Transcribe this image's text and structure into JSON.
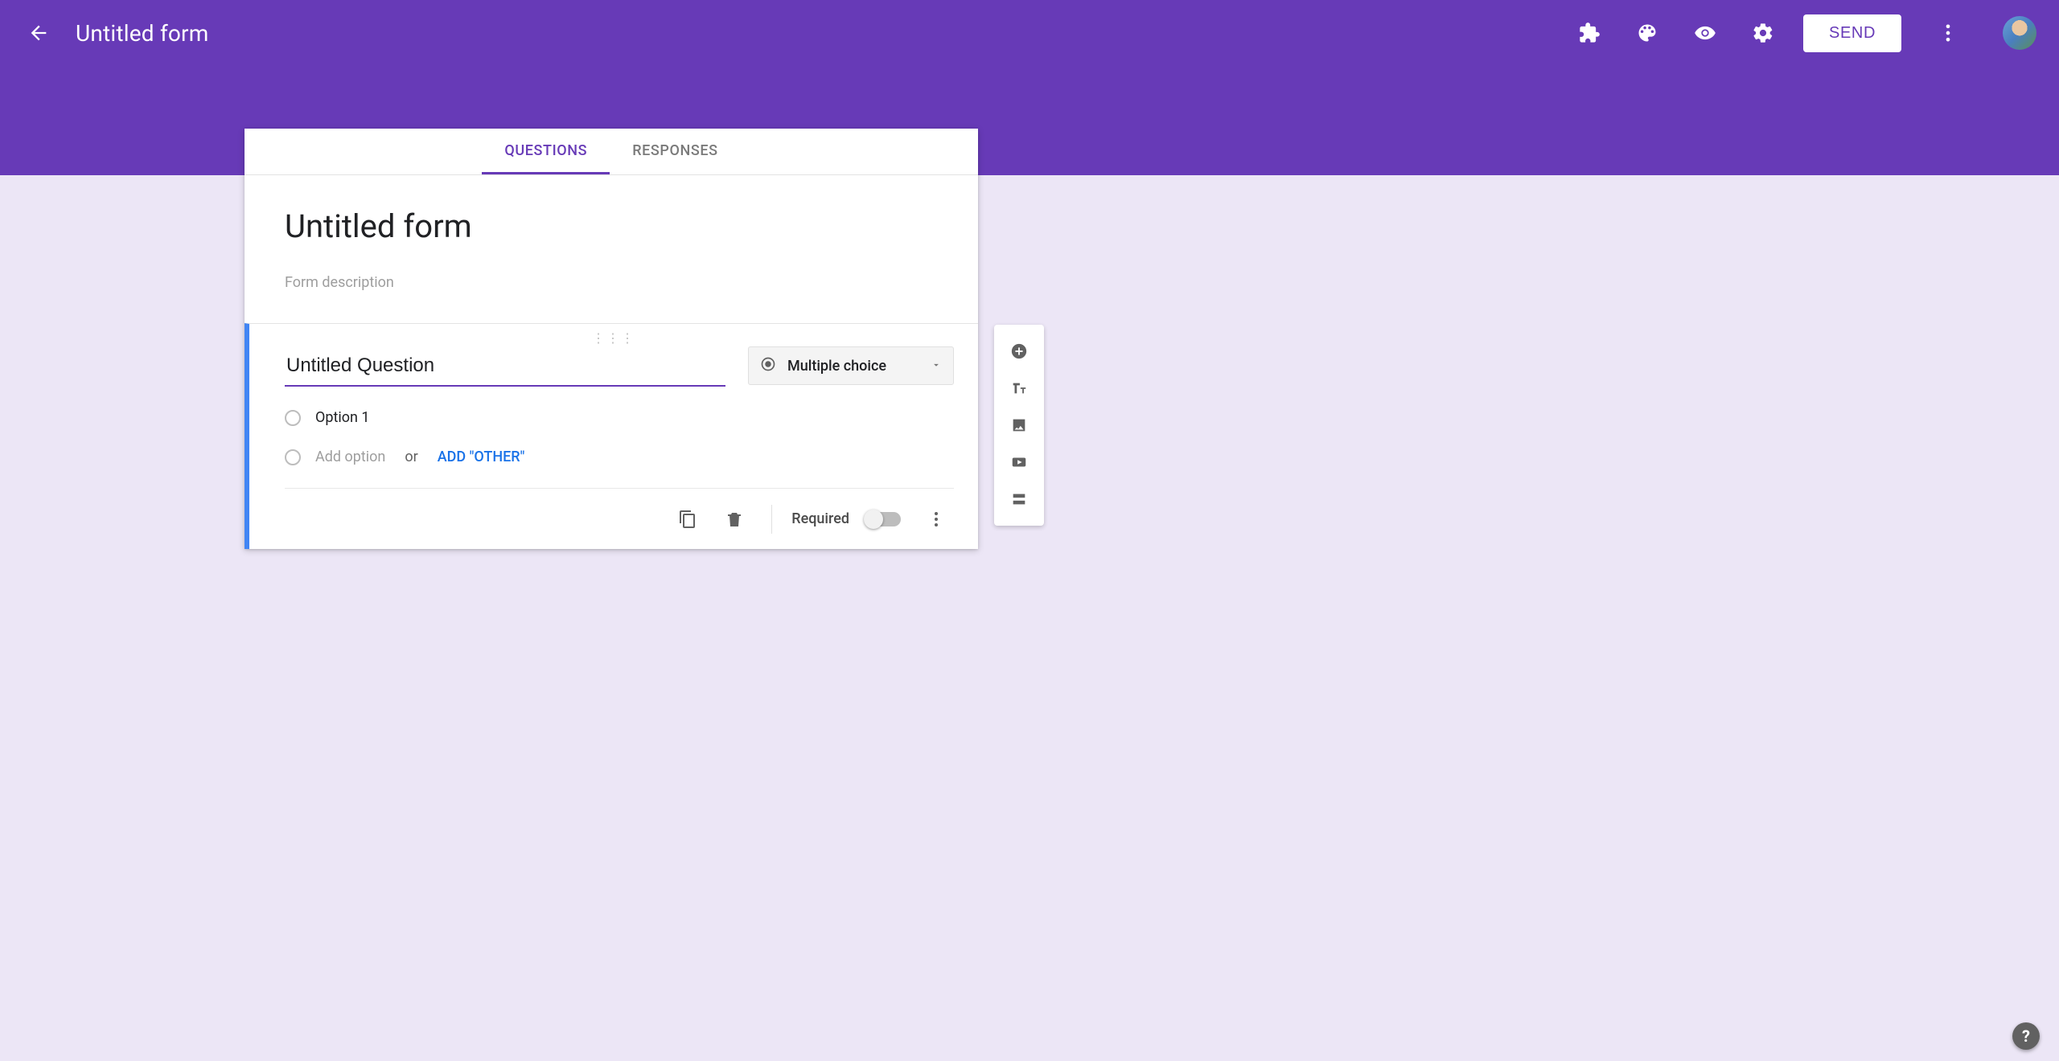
{
  "header": {
    "form_name": "Untitled form",
    "send_label": "SEND"
  },
  "tabs": {
    "questions": "QUESTIONS",
    "responses": "RESPONSES"
  },
  "form": {
    "title": "Untitled form",
    "description_placeholder": "Form description"
  },
  "question": {
    "title": "Untitled Question",
    "type_label": "Multiple choice",
    "options": [
      {
        "label": "Option 1"
      }
    ],
    "add_option_placeholder": "Add option",
    "or_word": "or",
    "add_other_label": "ADD \"OTHER\"",
    "required_label": "Required",
    "required": false
  },
  "icons": {
    "back": "arrow-left",
    "addons": "puzzle",
    "theme": "palette",
    "preview": "eye",
    "settings": "gear",
    "more": "kebab",
    "avatar": "user-avatar",
    "add_question": "plus-circle",
    "add_title": "Tt",
    "add_image": "image",
    "add_video": "play",
    "add_section": "sections",
    "copy": "copy",
    "delete": "trash",
    "help": "?"
  }
}
